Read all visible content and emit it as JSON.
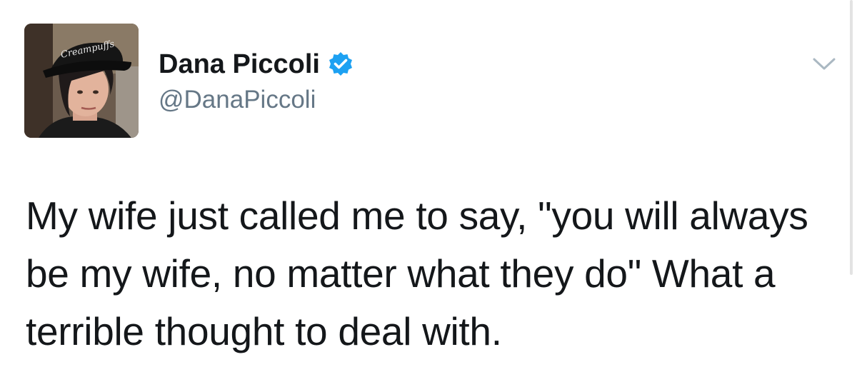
{
  "user": {
    "display_name": "Dana Piccoli",
    "handle": "@DanaPiccoli",
    "verified": true,
    "avatar_hat_text": "Creampuffs"
  },
  "tweet": {
    "text": "My wife just called me to say, \"you will always be my wife, no matter what they do\" What a terrible thought to deal with."
  },
  "icons": {
    "verified": "verified-badge-icon",
    "menu": "chevron-down-icon"
  },
  "colors": {
    "verified_blue": "#1da1f2",
    "handle_gray": "#657786",
    "caret_gray": "#aab8c2"
  }
}
